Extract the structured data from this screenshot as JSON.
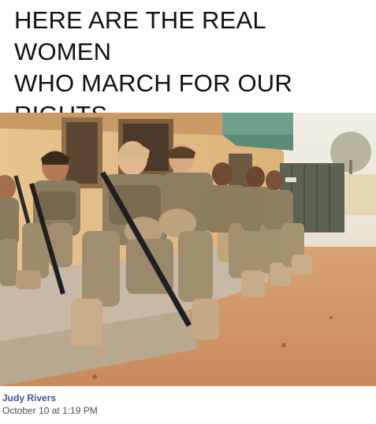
{
  "meme": {
    "caption": "HERE ARE THE REAL WOMEN\nWHO MARCH FOR OUR\nRIGHTS."
  },
  "post": {
    "author": "Judy Rivers",
    "timestamp": "October 10 at 1:19 PM"
  },
  "colors": {
    "author_link": "#365899",
    "timestamp_text": "#4b4f56",
    "caption_text": "#111111"
  }
}
